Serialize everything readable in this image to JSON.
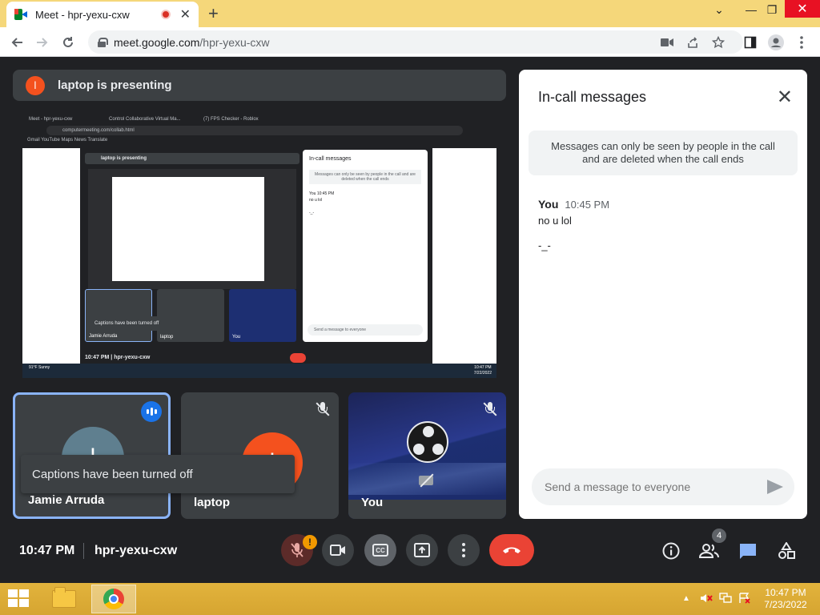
{
  "browser": {
    "tab_title": "Meet - hpr-yexu-cxw",
    "tab_close": "✕",
    "new_tab": "+",
    "url_host": "meet.google.com",
    "url_path": "/hpr-yexu-cxw",
    "window_controls": {
      "chevron": "⌄",
      "minimize": "—",
      "maximize": "❐",
      "close": "✕"
    }
  },
  "presenting_banner": {
    "avatar_initial": "l",
    "text": "laptop is presenting"
  },
  "shared_screen": {
    "tabs": [
      "Meet - hpr-yexu-cxw",
      "Control Collaborative Virtual Ma...",
      "(7) FPS Checker - Roblox"
    ],
    "url": "computermeeting.com/collab.html",
    "bookmarks": "Gmail   YouTube   Maps   News   Translate",
    "presenting_text": "laptop is presenting",
    "panel_title": "In-call messages",
    "panel_info": "Messages can only be seen by people in the call and are deleted when the call ends",
    "panel_msg_head": "You 10:45 PM",
    "panel_msg_1": "no u lol",
    "panel_msg_2": "-_-",
    "panel_input": "Send a message to everyone",
    "tiles": [
      "Jamie Arruda",
      "laptop",
      "You"
    ],
    "caption_toast": "Captions have been turned off",
    "bottom_time_code": "10:47 PM  |  hpr-yexu-cxw",
    "weather": "91°F\nSunny",
    "clock_time": "10:47 PM",
    "clock_date": "7/22/2022"
  },
  "tiles": [
    {
      "name": "Jamie Arruda",
      "initial": "l",
      "speaking": true
    },
    {
      "name": "laptop",
      "initial": "l",
      "muted": true
    },
    {
      "name": "You",
      "muted": true,
      "camera_off": true
    }
  ],
  "caption_toast": "Captions have been turned off",
  "chat_panel": {
    "title": "In-call messages",
    "close": "✕",
    "info": "Messages can only be seen by people in the call and are deleted when the call ends",
    "messages": [
      {
        "sender": "You",
        "time": "10:45 PM",
        "lines": [
          "no u lol",
          "-_-"
        ]
      }
    ],
    "input_placeholder": "Send a message to everyone"
  },
  "meeting": {
    "time": "10:47 PM",
    "code": "hpr-yexu-cxw",
    "mic_alert": "!",
    "cc_label": "CC",
    "people_count": "4"
  },
  "taskbar": {
    "tray_up": "▲",
    "clock_time": "10:47 PM",
    "clock_date": "7/23/2022"
  },
  "colors": {
    "meet_bg": "#202124",
    "tile_bg": "#3c4043",
    "end_call": "#ea4335",
    "accent_blue": "#1a73e8",
    "presenter_avatar": "#f4511e",
    "tab_strip": "#f5d77a"
  }
}
